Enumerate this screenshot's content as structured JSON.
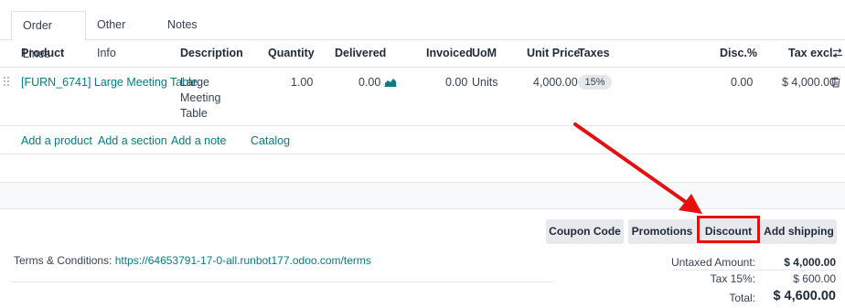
{
  "tabs": [
    "Order Lines",
    "Other Info",
    "Notes"
  ],
  "table": {
    "headers": {
      "product": "Product",
      "description": "Description",
      "quantity": "Quantity",
      "delivered": "Delivered",
      "invoiced": "Invoiced",
      "uom": "UoM",
      "unit_price": "Unit Price",
      "taxes": "Taxes",
      "disc": "Disc.%",
      "tax_excl": "Tax excl."
    },
    "row": {
      "product": "[FURN_6741] Large Meeting Table.",
      "description": [
        "Large",
        "Meeting",
        "Table"
      ],
      "quantity": "1.00",
      "delivered": "0.00",
      "invoiced": "0.00",
      "uom": "Units",
      "unit_price": "4,000.00",
      "tax": "15%",
      "disc": "0.00",
      "subtotal": "$ 4,000.00"
    }
  },
  "add_links": {
    "product": "Add a product",
    "section": "Add a section",
    "note": "Add a note",
    "catalog": "Catalog"
  },
  "buttons": {
    "coupon": "Coupon Code",
    "promotions": "Promotions",
    "discount": "Discount",
    "shipping": "Add shipping"
  },
  "terms": {
    "label": "Terms & Conditions: ",
    "url": "https://64653791-17-0-all.runbot177.odoo.com/terms"
  },
  "totals": {
    "untaxed_label": "Untaxed Amount:",
    "untaxed_value": "$ 4,000.00",
    "tax_label": "Tax 15%:",
    "tax_value": "$ 600.00",
    "total_label": "Total:",
    "total_value": "$ 4,600.00"
  },
  "colors": {
    "link": "#017e84",
    "annotation": "#e8100f"
  }
}
